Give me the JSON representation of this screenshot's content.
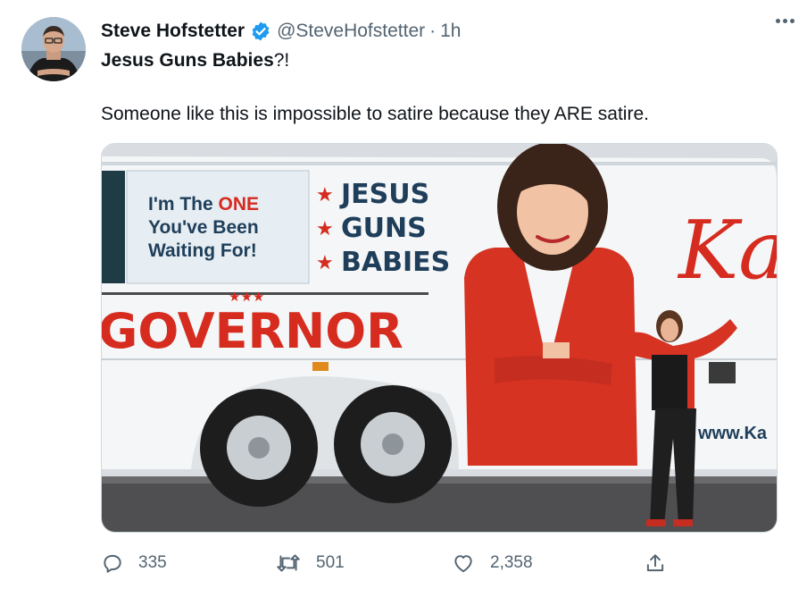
{
  "tweet": {
    "author_name": "Steve Hofstetter",
    "author_handle": "@SteveHofstetter",
    "separator": "·",
    "time": "1h",
    "text_bold": "Jesus Guns Babies",
    "text_punct": "?!",
    "text_body": "Someone like this is impossible to satire because they ARE satire.",
    "media": {
      "bus_text_1": "I'm The ",
      "bus_text_1_accent": "ONE",
      "bus_text_2": "You've Been",
      "bus_text_3": "Waiting For!",
      "slogan": [
        "JESUS",
        "GUNS",
        "BABIES"
      ],
      "office": "GOVERNOR",
      "script_letter": "Ka",
      "url_fragment": "www.Ka",
      "accent_color": "#d62b1f"
    },
    "counts": {
      "replies": "335",
      "retweets": "501",
      "likes": "2,358"
    }
  },
  "icons": {
    "verified": "verified-badge-icon",
    "more": "more-icon",
    "reply": "reply-icon",
    "retweet": "retweet-icon",
    "like": "like-icon",
    "share": "share-icon"
  },
  "colors": {
    "verified": "#1d9bf0",
    "secondary_text": "#536471",
    "primary_text": "#0f1419"
  }
}
